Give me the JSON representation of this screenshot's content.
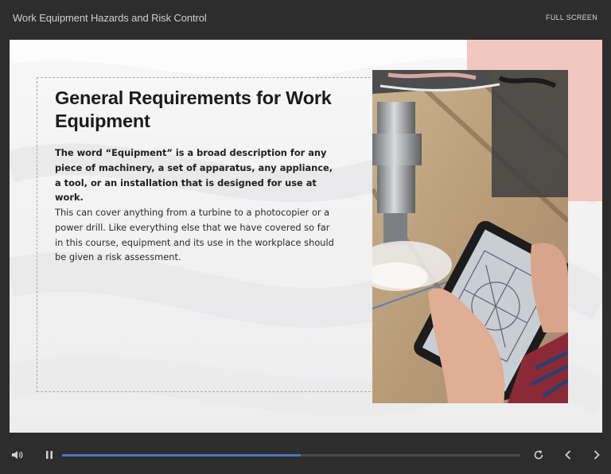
{
  "header": {
    "course_title": "Work Equipment Hazards and Risk Control",
    "fullscreen_label": "FULL SCREEN"
  },
  "slide": {
    "title": "General Requirements for Work Equipment",
    "paragraph_bold": "The word “Equipment” is a broad description for any piece of machinery, a set of apparatus, any appliance, a tool, or an installation that is designed for use at work.",
    "paragraph_body": "This can cover anything from a turbine to a photocopier or a power drill. Like everything else that we have covered so far in this course, equipment and its use in the workplace should be given a risk assessment.",
    "accent_color": "#f0c8c0"
  },
  "player": {
    "progress_fraction": 0.52,
    "accent_color": "#4a78c0",
    "icons": [
      "volume-icon",
      "pause-icon",
      "replay-icon",
      "chevron-left-icon",
      "chevron-right-icon"
    ]
  }
}
